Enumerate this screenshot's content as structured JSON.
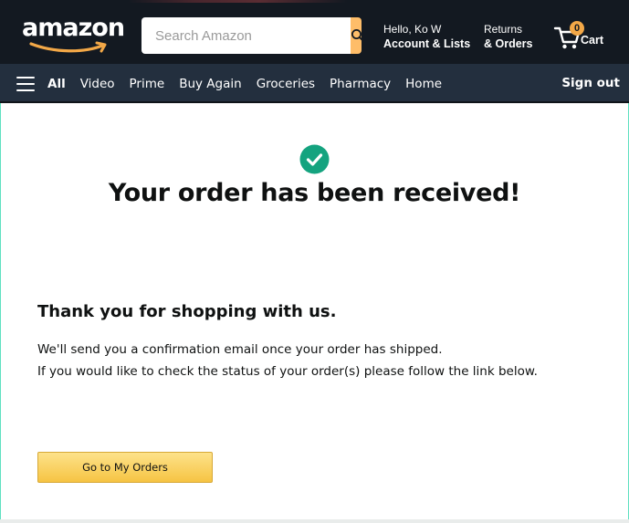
{
  "header": {
    "logo_text": "amazon",
    "search": {
      "placeholder": "Search Amazon",
      "value": ""
    },
    "account": {
      "greeting": "Hello, Ko W",
      "label": "Account & Lists"
    },
    "returns": {
      "line1": "Returns",
      "line2": "& Orders"
    },
    "cart": {
      "count": "0",
      "label": "Cart"
    }
  },
  "nav": {
    "all_label": "All",
    "items": [
      "Video",
      "Prime",
      "Buy Again",
      "Groceries",
      "Pharmacy",
      "Home"
    ],
    "signout_label": "Sign out"
  },
  "main": {
    "headline": "Your order has been received!",
    "thanks": "Thank you for shopping with us.",
    "message_line1": "We'll send you a confirmation email once your order has shipped.",
    "message_line2": "If you would like to check the status of your order(s) please follow the link below.",
    "orders_button_label": "Go to My Orders"
  },
  "colors": {
    "header_bg": "#131921",
    "nav_bg": "#232f3e",
    "search_button": "#febd69",
    "cart_badge": "#f3a847",
    "success_check": "#14a37f",
    "button_yellow": "#f6c443"
  },
  "icons": [
    "amazon-smile-logo",
    "search-icon",
    "cart-icon",
    "hamburger-menu-icon",
    "check-circle-icon"
  ]
}
